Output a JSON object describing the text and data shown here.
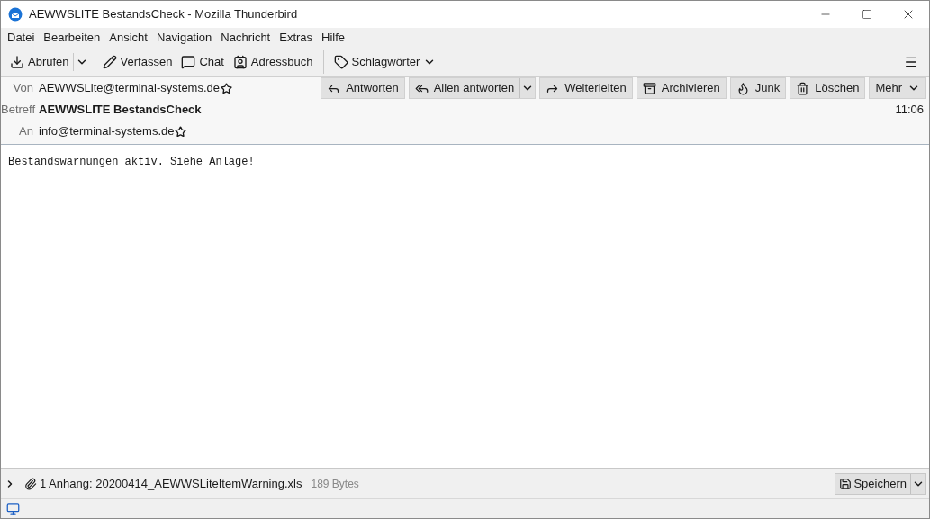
{
  "window": {
    "title": "AEWWSLITE BestandsCheck - Mozilla Thunderbird"
  },
  "menu": [
    "Datei",
    "Bearbeiten",
    "Ansicht",
    "Navigation",
    "Nachricht",
    "Extras",
    "Hilfe"
  ],
  "toolbar": [
    {
      "kind": "split",
      "label": "Abrufen"
    },
    {
      "kind": "plain",
      "label": "Verfassen"
    },
    {
      "kind": "plain",
      "label": "Chat"
    },
    {
      "kind": "plain",
      "label": "Adressbuch"
    },
    {
      "kind": "separator"
    },
    {
      "kind": "dropdown",
      "label": "Schlagwörter"
    }
  ],
  "header": {
    "fields": [
      {
        "label": "Von",
        "value": "AEWWSLite@terminal-systems.de",
        "kind": "address"
      },
      {
        "label": "Betreff",
        "value": "AEWWSLITE BestandsCheck",
        "kind": "subject"
      },
      {
        "label": "An",
        "value": "info@terminal-systems.de",
        "kind": "address"
      }
    ],
    "time": "11:06",
    "actions": [
      {
        "kind": "plain",
        "label": "Antworten"
      },
      {
        "kind": "split",
        "label": "Allen antworten"
      },
      {
        "kind": "plain",
        "label": "Weiterleiten"
      },
      {
        "kind": "plain",
        "label": "Archivieren"
      },
      {
        "kind": "plain",
        "label": "Junk"
      },
      {
        "kind": "plain",
        "label": "Löschen"
      },
      {
        "kind": "dropdown",
        "label": "Mehr"
      }
    ]
  },
  "body": "Bestandswarnungen aktiv. Siehe Anlage!",
  "attachments": {
    "expanded": false,
    "summary": "1 Anhang: 20200414_AEWWSLiteItemWarning.xls",
    "size": "189 Bytes",
    "save": "Speichern"
  }
}
